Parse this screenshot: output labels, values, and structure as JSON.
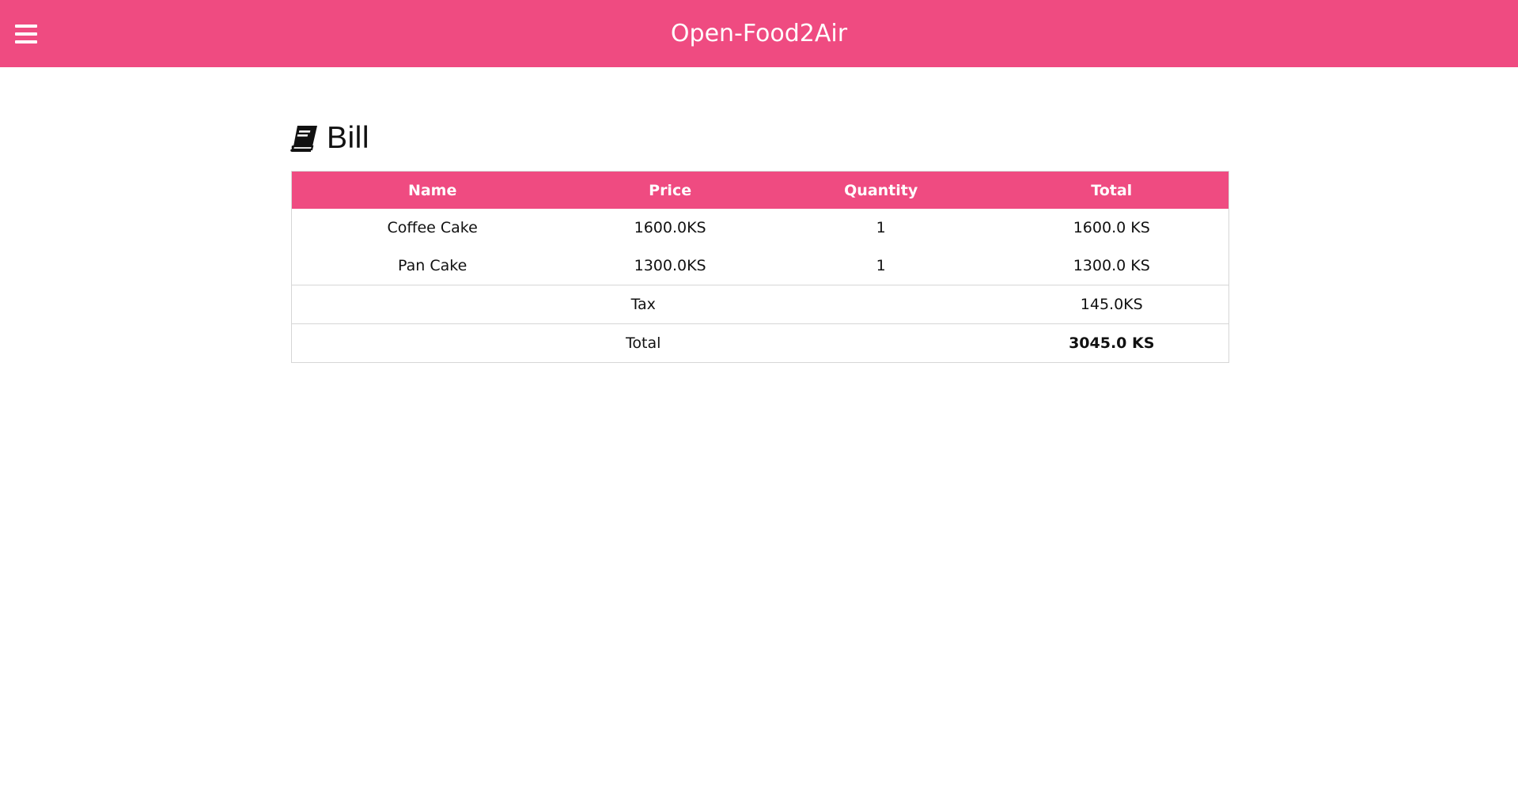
{
  "app": {
    "title": "Open-Food2Air"
  },
  "page": {
    "heading": "Bill",
    "heading_icon": "book-icon"
  },
  "bill": {
    "columns": [
      "Name",
      "Price",
      "Quantity",
      "Total"
    ],
    "items": [
      {
        "name": "Coffee Cake",
        "price": "1600.0KS",
        "quantity": "1",
        "total": "1600.0 KS"
      },
      {
        "name": "Pan Cake",
        "price": "1300.0KS",
        "quantity": "1",
        "total": "1300.0 KS"
      }
    ],
    "tax": {
      "label": "Tax",
      "value": "145.0KS"
    },
    "grand_total": {
      "label": "Total",
      "value": "3045.0 KS"
    }
  },
  "colors": {
    "accent": "#ef4b81",
    "text": "#111111",
    "border": "#d6d6d6"
  }
}
